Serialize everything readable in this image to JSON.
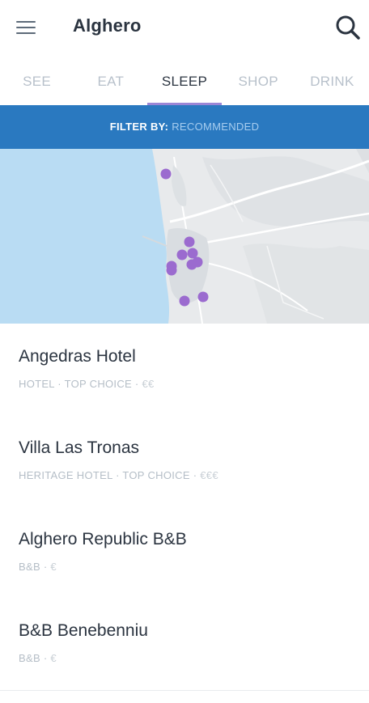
{
  "header": {
    "title": "Alghero",
    "menu_icon": "hamburger-menu-icon",
    "search_icon": "search-icon"
  },
  "tabs": [
    {
      "label": "SEE",
      "active": false
    },
    {
      "label": "EAT",
      "active": false
    },
    {
      "label": "SLEEP",
      "active": true
    },
    {
      "label": "SHOP",
      "active": false
    },
    {
      "label": "DRINK",
      "active": false
    }
  ],
  "filter": {
    "label": "FILTER BY:",
    "value": "RECOMMENDED"
  },
  "colors": {
    "accent": "#2a79c0",
    "tab_indicator": "#9b86d6",
    "map_pin": "#9b6bcf",
    "water": "#b9dcf3"
  },
  "listings": [
    {
      "name": "Angedras Hotel",
      "type": "HOTEL",
      "tag": "TOP CHOICE",
      "price": "€€"
    },
    {
      "name": "Villa Las Tronas",
      "type": "HERITAGE HOTEL",
      "tag": "TOP CHOICE",
      "price": "€€€"
    },
    {
      "name": "Alghero Republic B&B",
      "type": "B&B",
      "tag": "",
      "price": "€"
    },
    {
      "name": "B&B Benebenniu",
      "type": "B&B",
      "tag": "",
      "price": "€"
    }
  ]
}
